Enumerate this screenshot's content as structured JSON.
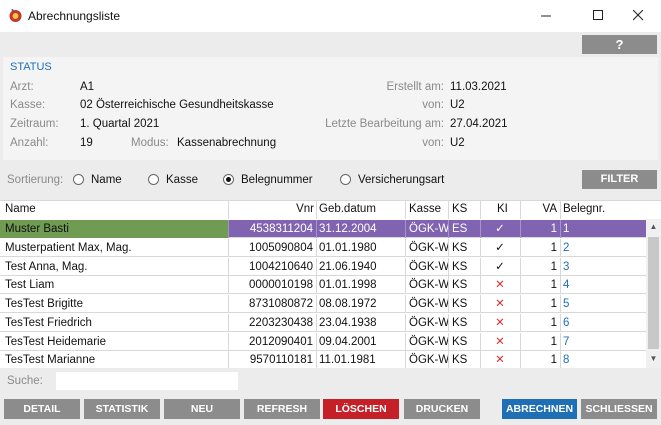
{
  "window": {
    "title": "Abrechnungsliste"
  },
  "help_label": "?",
  "status": {
    "title": "STATUS",
    "arzt_label": "Arzt:",
    "arzt_value": "A1",
    "kasse_label": "Kasse:",
    "kasse_value": "02  Österreichische Gesundheitskasse",
    "zeitraum_label": "Zeitraum:",
    "zeitraum_value": "1. Quartal 2021",
    "anzahl_label": "Anzahl:",
    "anzahl_value": "19",
    "modus_label": "Modus:",
    "modus_value": "Kassenabrechnung",
    "erstellt_label": "Erstellt am:",
    "erstellt_value": "11.03.2021",
    "von1_label": "von:",
    "von1_value": "U2",
    "bearbeitung_label": "Letzte Bearbeitung am:",
    "bearbeitung_value": "27.04.2021",
    "von2_label": "von:",
    "von2_value": "U2"
  },
  "sort": {
    "label": "Sortierung:",
    "options": [
      "Name",
      "Kasse",
      "Belegnummer",
      "Versicherungsart"
    ],
    "selected": "Belegnummer"
  },
  "filter_label": "FILTER",
  "table": {
    "headers": {
      "name": "Name",
      "vnr": "Vnr",
      "gebdatum": "Geb.datum",
      "kasse": "Kasse",
      "ks": "KS",
      "ki": "KI",
      "va": "VA",
      "belegnr": "Belegnr."
    },
    "rows": [
      {
        "name": "Muster Basti",
        "vnr": "4538311204",
        "gebdatum": "31.12.2004",
        "kasse": "ÖGK-W",
        "ks": "ES",
        "ki": "check",
        "va": "1",
        "belegnr": "1"
      },
      {
        "name": "Musterpatient Max, Mag.",
        "vnr": "1005090804",
        "gebdatum": "01.01.1980",
        "kasse": "ÖGK-W",
        "ks": "KS",
        "ki": "check",
        "va": "1",
        "belegnr": "2"
      },
      {
        "name": "Test Anna, Mag.",
        "vnr": "1004210640",
        "gebdatum": "21.06.1940",
        "kasse": "ÖGK-W",
        "ks": "KS",
        "ki": "check",
        "va": "1",
        "belegnr": "3"
      },
      {
        "name": "Test Liam",
        "vnr": "0000010198",
        "gebdatum": "01.01.1998",
        "kasse": "ÖGK-W",
        "ks": "KS",
        "ki": "cross",
        "va": "1",
        "belegnr": "4"
      },
      {
        "name": "TesTest Brigitte",
        "vnr": "8731080872",
        "gebdatum": "08.08.1972",
        "kasse": "ÖGK-W",
        "ks": "KS",
        "ki": "cross",
        "va": "1",
        "belegnr": "5"
      },
      {
        "name": "TesTest Friedrich",
        "vnr": "2203230438",
        "gebdatum": "23.04.1938",
        "kasse": "ÖGK-W",
        "ks": "KS",
        "ki": "cross",
        "va": "1",
        "belegnr": "6"
      },
      {
        "name": "TesTest Heidemarie",
        "vnr": "2012090401",
        "gebdatum": "09.04.2001",
        "kasse": "ÖGK-W",
        "ks": "KS",
        "ki": "cross",
        "va": "1",
        "belegnr": "7"
      },
      {
        "name": "TesTest Marianne",
        "vnr": "9570110181",
        "gebdatum": "11.01.1981",
        "kasse": "ÖGK-W",
        "ks": "KS",
        "ki": "cross",
        "va": "1",
        "belegnr": "8"
      }
    ]
  },
  "search": {
    "label": "Suche:",
    "value": ""
  },
  "buttons": {
    "detail": "DETAIL",
    "statistik": "STATISTIK",
    "neu": "NEU",
    "refresh": "REFRESH",
    "loeschen": "LÖSCHEN",
    "drucken": "DRUCKEN",
    "abrechnen": "ABRECHNEN",
    "schliessen": "SCHLIESSEN"
  },
  "colors": {
    "accent": "#1f6fb5",
    "selected_row": "#8064b1",
    "selected_name": "#6f9b52",
    "delete": "#c52027",
    "cross": "#d53131"
  }
}
